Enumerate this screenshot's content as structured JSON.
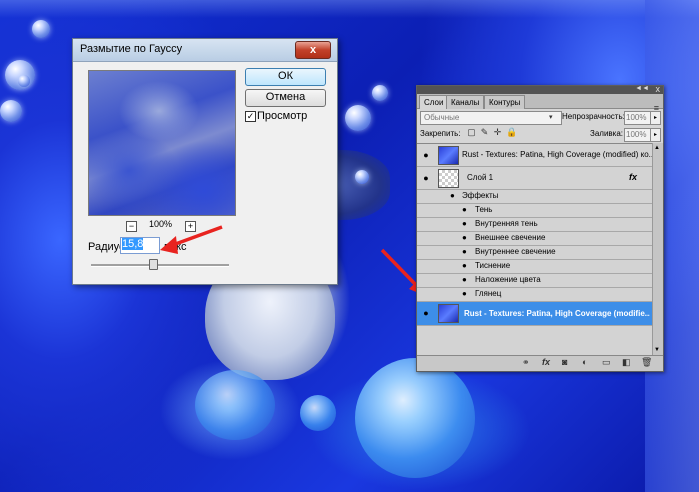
{
  "dialog": {
    "title": "Размытие по Гауссу",
    "close_label": "x",
    "zoom_out": "−",
    "zoom_level": "100%",
    "zoom_in": "+",
    "ok_label": "ОК",
    "cancel_label": "Отмена",
    "preview_checked": "✓",
    "preview_label": "Просмотр",
    "radius_label": "Радиус:",
    "radius_value": "15,8",
    "radius_unit": "пикс",
    "slider_fraction": 0.45
  },
  "layers_panel": {
    "collapse": "◄◄",
    "close": "x",
    "menu": "≡",
    "tabs": [
      {
        "label": "Слои"
      },
      {
        "label": "Каналы"
      },
      {
        "label": "Контуры"
      }
    ],
    "blend_mode": "Обычные",
    "blend_arrow": "▾",
    "opacity_label": "Непрозрачность:",
    "opacity_value": "100%",
    "lock_label": "Закрепить:",
    "fill_label": "Заливка:",
    "fill_value": "100%",
    "stepper_arrow": "▸",
    "icons": {
      "eye": "●",
      "fx": "fx",
      "lock_transparent": "▢",
      "lock_brush": "✎",
      "lock_move": "✛",
      "lock_all": "🔒"
    },
    "layers": [
      {
        "name": "Rust - Textures: Patina, High Coverage (modified) ко..."
      },
      {
        "name": "Слой 1"
      },
      {
        "name": "Эффекты"
      },
      {
        "name": "Тень"
      },
      {
        "name": "Внутренняя тень"
      },
      {
        "name": "Внешнее свечение"
      },
      {
        "name": "Внутреннее свечение"
      },
      {
        "name": "Тиснение"
      },
      {
        "name": "Наложение цвета"
      },
      {
        "name": "Глянец"
      },
      {
        "name": "Rust - Textures: Patina, High Coverage (modifie..."
      }
    ],
    "footer_icons": [
      "⚭",
      "fx",
      "◙",
      "◐",
      "▭",
      "◧",
      "🗑"
    ]
  },
  "colors": {
    "selected_layer": "#3d8ee8",
    "arrow": "#e8231f"
  }
}
